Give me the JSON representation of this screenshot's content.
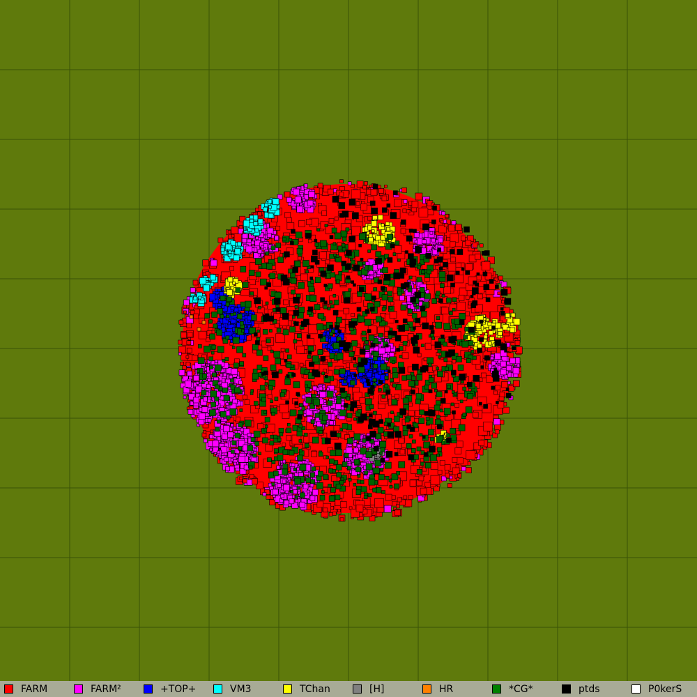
{
  "map": {
    "background_color": "#5f7a0c",
    "grid_color": "#3a5206",
    "grid_cells": 10,
    "territory_colors": {
      "FARM": "#ff0000",
      "FARM2": "#ff00ff",
      "TOP": "#0000ff",
      "VM3": "#00ffff",
      "TChan": "#ffff00",
      "H": "#808080",
      "HR": "#ff8000",
      "CG": "#006400",
      "ptds": "#000000",
      "P0kerS": "#ffffff"
    }
  },
  "legend": {
    "items": [
      {
        "label": "FARM",
        "color": "#ff0000"
      },
      {
        "label": "FARM²",
        "color": "#ff00ff"
      },
      {
        "label": "+TOP+",
        "color": "#0000ff"
      },
      {
        "label": "VM3",
        "color": "#00ffff"
      },
      {
        "label": "TChan",
        "color": "#ffff00"
      },
      {
        "label": "[H]",
        "color": "#808080"
      },
      {
        "label": "HR",
        "color": "#ff8000"
      },
      {
        "label": "*CG*",
        "color": "#008000"
      },
      {
        "label": "ptds",
        "color": "#000000"
      },
      {
        "label": "P0kerS",
        "color": "#ffffff"
      }
    ]
  }
}
